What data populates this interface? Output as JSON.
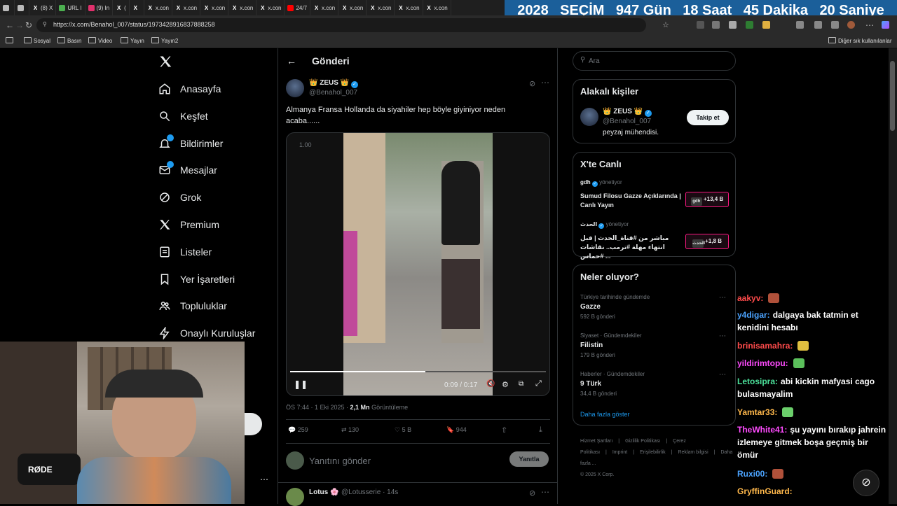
{
  "tabs": [
    {
      "title": "",
      "color": "#bbb"
    },
    {
      "title": "",
      "color": "#bbb"
    },
    {
      "title": "(8) X",
      "color": "#fff"
    },
    {
      "title": "URL I",
      "color": "#4caf50"
    },
    {
      "title": "(9) In",
      "color": "#e1306c"
    },
    {
      "title": "(",
      "color": "#fff"
    },
    {
      "title": "",
      "color": "#fff"
    },
    {
      "title": "x.con",
      "color": "#fff"
    },
    {
      "title": "x.con",
      "color": "#fff"
    },
    {
      "title": "x.con",
      "color": "#fff"
    },
    {
      "title": "x.con",
      "color": "#fff"
    },
    {
      "title": "x.con",
      "color": "#fff"
    },
    {
      "title": "24/7",
      "color": "#ff0000"
    },
    {
      "title": "x.con",
      "color": "#fff"
    },
    {
      "title": "x.con",
      "color": "#fff"
    },
    {
      "title": "x.con",
      "color": "#fff"
    },
    {
      "title": "x.con",
      "color": "#fff"
    },
    {
      "title": "x.con",
      "color": "#fff"
    }
  ],
  "countdown": {
    "year": "2028",
    "label": "SEÇİM",
    "days": "947 Gün",
    "hours": "18 Saat",
    "minutes": "45 Dakika",
    "seconds": "20 Saniye"
  },
  "browser": {
    "url": "https://x.com/Benahol_007/status/1973428916837888258",
    "bookmarks": [
      "Sosyal",
      "Basın",
      "Video",
      "Yayın",
      "Yayın2"
    ],
    "other_bookmarks": "Diğer sık kullanılanlar"
  },
  "sidebar": {
    "logo": "X",
    "items": [
      {
        "label": "Anasayfa",
        "icon": "home-icon"
      },
      {
        "label": "Keşfet",
        "icon": "search-icon"
      },
      {
        "label": "Bildirimler",
        "icon": "bell-icon"
      },
      {
        "label": "Mesajlar",
        "icon": "mail-icon"
      },
      {
        "label": "Grok",
        "icon": "grok-icon"
      },
      {
        "label": "Premium",
        "icon": "x-icon"
      },
      {
        "label": "Listeler",
        "icon": "list-icon"
      },
      {
        "label": "Yer İşaretleri",
        "icon": "bookmark-icon"
      },
      {
        "label": "Topluluklar",
        "icon": "people-icon"
      },
      {
        "label": "Onaylı Kuruluşlar",
        "icon": "lightning-icon"
      }
    ]
  },
  "post": {
    "header_title": "Gönderi",
    "author_name": "👑 ZEUS 👑",
    "author_handle": "@Benahol_007",
    "text": "Almanya Fransa Hollanda da siyahiler hep böyle giyiniyor neden acaba......",
    "video": {
      "speed": "1.00",
      "time": "0:09 / 0:17",
      "progress": 0.53
    },
    "timestamp": "ÖS 7:44 · 1 Eki 2025 · ",
    "views_count": "2,1 Mn",
    "views_label": " Görüntüleme",
    "replies": "259",
    "reposts": "130",
    "likes": "5 B",
    "bookmarks": "944",
    "reply_placeholder": "Yanıtını gönder",
    "reply_button": "Yanıtla"
  },
  "reply_preview": {
    "name": "Lotus 🌸",
    "handle": "@Lotusserie · 14s"
  },
  "search": {
    "placeholder": "Ara"
  },
  "related": {
    "title": "Alakalı kişiler",
    "name": "👑 ZEUS 👑",
    "handle": "@Benahol_007",
    "bio": "peyzaj mühendisi.",
    "follow_label": "Takip et"
  },
  "live": {
    "title": "X'te Canlı",
    "items": [
      {
        "host": "gdh",
        "role": "yönetiyor",
        "title": "Sumud Filosu Gazze Açıklarında | Canlı Yayın",
        "count": "+13,4 B",
        "badge": "gdh"
      },
      {
        "host": "الحدث",
        "role": "yönetiyor",
        "title": "مباشر من #قناة_الحدث | قبل انتهاء مهلة #ترمب.. نقاشات #حماس ...",
        "count": "+1,8 B",
        "badge": "الحدث"
      }
    ]
  },
  "trends": {
    "title": "Neler oluyor?",
    "items": [
      {
        "context": "Türkiye tarihinde gündemde",
        "name": "Gazze",
        "posts": "592 B gönderi"
      },
      {
        "context": "Siyaset · Gündemdekiler",
        "name": "Filistin",
        "posts": "179 B gönderi"
      },
      {
        "context": "Haberler · Gündemdekiler",
        "name": "9 Türk",
        "posts": "34,4 B gönderi"
      }
    ],
    "more": "Daha fazla göster"
  },
  "footer": {
    "links": [
      "Hizmet Şartları",
      "Gizlilik Politikası",
      "Çerez Politikası",
      "Imprint",
      "Erişilebilirlik",
      "Reklam bilgisi",
      "Daha fazla ..."
    ],
    "copyright": "© 2025 X Corp."
  },
  "chat": [
    {
      "user": "aakyv:",
      "color": "#ff4b4b",
      "text": "",
      "emote": "#b0513a"
    },
    {
      "user": "y4digar:",
      "color": "#4ba3ff",
      "text": "dalgaya bak tatmin et kenidini hesabı"
    },
    {
      "user": "brinisamahra:",
      "color": "#ff4b4b",
      "text": "",
      "emote": "#e0c040"
    },
    {
      "user": "yildirimtopu:",
      "color": "#ff4bff",
      "text": "",
      "emote": "#5bc05b"
    },
    {
      "user": "Letosipra:",
      "color": "#4be09a",
      "text": "abi kickin mafyasi cago bulasmayalim"
    },
    {
      "user": "Yamtar33:",
      "color": "#ffb84b",
      "text": "",
      "emote": "#6bcf6b"
    },
    {
      "user": "TheWhite41:",
      "color": "#ff4bff",
      "text": "şu yayını bırakıp jahrein izlemeye gitmek boşa geçmiş bir ömür"
    },
    {
      "user": "Ruxi00:",
      "color": "#4ba3ff",
      "text": "",
      "emote": "#b0513a"
    },
    {
      "user": "GryffinGuard:",
      "color": "#ffb84b",
      "text": ""
    }
  ],
  "webcam": {
    "mic_label": "RØDE"
  }
}
